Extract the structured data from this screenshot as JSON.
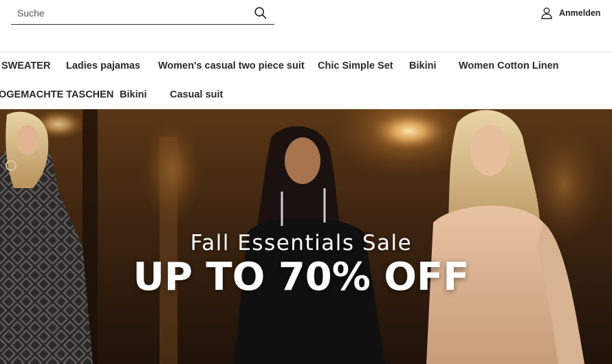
{
  "search": {
    "placeholder": "Suche",
    "value": "",
    "icon": "search-icon"
  },
  "account": {
    "label": "Anmelden",
    "icon": "user-icon"
  },
  "nav": {
    "row1": [
      "SWEATER",
      "Ladies pajamas",
      "Women's casual two piece suit",
      "Chic Simple Set",
      "Bikini",
      "Women Cotton Linen"
    ],
    "row2": [
      "OGEMACHTE TASCHEN",
      "Bikini",
      "Casual suit"
    ]
  },
  "hero": {
    "subtitle": "Fall Essentials Sale",
    "title": "UP TO 70% OFF"
  },
  "colors": {
    "text": "#222222",
    "divider": "#e3e3e3",
    "hero_text": "#ffffff",
    "hero_warm": "#b07a3c"
  }
}
